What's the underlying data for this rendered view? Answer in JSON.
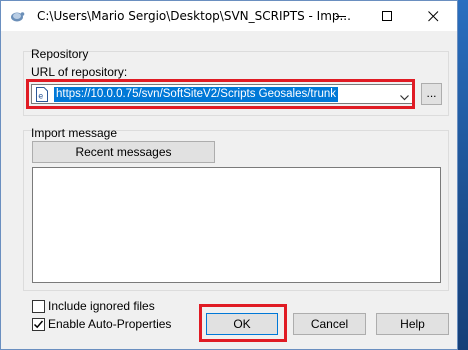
{
  "window": {
    "title": "C:\\Users\\Mario Sergio\\Desktop\\SVN_SCRIPTS - Imp...",
    "icons": {
      "app": "tortoisesvn-icon",
      "minimize": "minimize-icon",
      "maximize": "maximize-icon",
      "close": "close-icon"
    }
  },
  "repository": {
    "group_label": "Repository",
    "url_label": "URL of repository:",
    "url_value": "https://10.0.0.75/svn/SoftSiteV2/Scripts Geosales/trunk",
    "browse_label": "..."
  },
  "import_message": {
    "group_label": "Import message",
    "recent_button": "Recent messages",
    "message_text": ""
  },
  "options": {
    "include_ignored_label": "Include ignored files",
    "include_ignored_checked": false,
    "auto_props_label": "Enable Auto-Properties",
    "auto_props_checked": true
  },
  "buttons": {
    "ok": "OK",
    "cancel": "Cancel",
    "help": "Help"
  },
  "colors": {
    "highlight": "#e01b24",
    "selection": "#0078d7"
  }
}
